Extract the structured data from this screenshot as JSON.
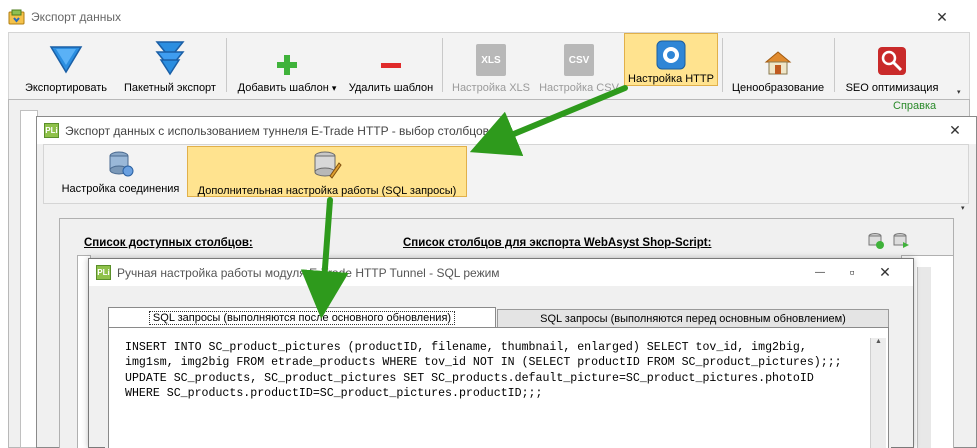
{
  "main_window": {
    "title": "Экспорт данных",
    "toolbar": [
      {
        "label": "Экспортировать",
        "icon": "funnel-export-icon"
      },
      {
        "label": "Пакетный экспорт",
        "icon": "batch-export-icon"
      },
      {
        "label": "Добавить шаблон",
        "icon": "plus-icon",
        "dropdown": "▾"
      },
      {
        "label": "Удалить шаблон",
        "icon": "minus-icon"
      },
      {
        "label": "Настройка XLS",
        "icon_text": "XLS",
        "disabled": true
      },
      {
        "label": "Настройка CSV",
        "icon_text": "CSV",
        "disabled": true
      },
      {
        "label": "Настройка HTTP",
        "icon": "http-settings-icon",
        "active": true
      },
      {
        "label": "Ценообразование",
        "icon": "pricing-icon"
      },
      {
        "label": "SEO оптимизация",
        "icon": "seo-icon"
      }
    ],
    "help_link": "Справка",
    "close_glyph": "✕"
  },
  "tunnel_window": {
    "title": "Экспорт данных с использованием туннеля E-Trade HTTP - выбор столбцов",
    "icon_text": "PLi",
    "toolbar": [
      {
        "label": "Настройка соединения",
        "icon": "connection-settings-icon"
      },
      {
        "label": "Дополнительная настройка работы (SQL запросы)",
        "icon": "database-edit-icon",
        "active": true
      }
    ],
    "available_columns_label": "Список доступных столбцов:",
    "export_columns_label": "Список столбцов для экспорта WebAsyst Shop-Script:",
    "close_glyph": "✕"
  },
  "sql_window": {
    "title": "Ручная настройка работы модуля E-Trade HTTP Tunnel - SQL режим",
    "icon_text": "PLi",
    "minimize_glyph": "—",
    "maximize_glyph": "▫",
    "close_glyph": "✕",
    "tabs": [
      {
        "label": "SQL запросы (выполняются после основного обновления)",
        "selected": true
      },
      {
        "label": "SQL запросы (выполняются перед основным обновлением)",
        "selected": false
      }
    ],
    "sql_lines": [
      "INSERT INTO SC_product_pictures (productID, filename, thumbnail, enlarged) SELECT tov_id, img2big,",
      "img1sm, img2big FROM etrade_products WHERE tov_id NOT IN (SELECT productID FROM SC_product_pictures);;;",
      "UPDATE SC_products, SC_product_pictures SET SC_products.default_picture=SC_product_pictures.photoID",
      "WHERE SC_products.productID=SC_product_pictures.productID;;;"
    ]
  },
  "colors": {
    "accent_active": "#ffe38f",
    "arrow_green": "#2e9a1c",
    "help_link": "#2a8a2a"
  }
}
